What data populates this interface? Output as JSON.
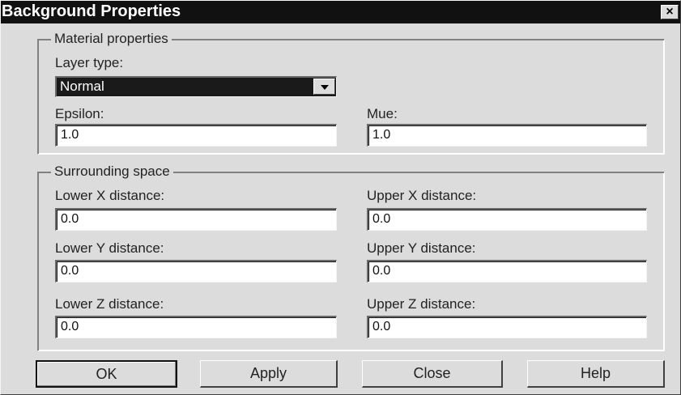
{
  "window": {
    "title": "Background Properties",
    "close_glyph": "×"
  },
  "material": {
    "group_label": "Material properties",
    "layer_type_label": "Layer type:",
    "layer_type_value": "Normal",
    "epsilon_label": "Epsilon:",
    "epsilon_value": "1.0",
    "mue_label": "Mue:",
    "mue_value": "1.0"
  },
  "surrounding": {
    "group_label": "Surrounding space",
    "lower_x_label": "Lower X distance:",
    "lower_x_value": "0.0",
    "upper_x_label": "Upper X distance:",
    "upper_x_value": "0.0",
    "lower_y_label": "Lower Y distance:",
    "lower_y_value": "0.0",
    "upper_y_label": "Upper Y distance:",
    "upper_y_value": "0.0",
    "lower_z_label": "Lower Z distance:",
    "lower_z_value": "0.0",
    "upper_z_label": "Upper Z distance:",
    "upper_z_value": "0.0"
  },
  "buttons": {
    "ok": "OK",
    "apply": "Apply",
    "close": "Close",
    "help": "Help"
  },
  "icons": {
    "close": "close-icon",
    "dropdown": "chevron-down-icon"
  }
}
